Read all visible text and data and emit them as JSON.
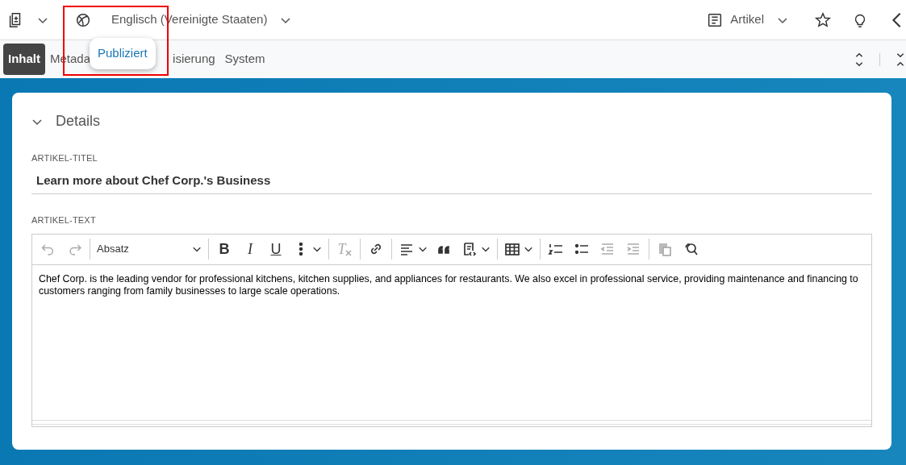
{
  "topbar": {
    "language": "Englisch (Vereinigte Staaten)",
    "doctype": "Artikel"
  },
  "status_tooltip": "Publiziert",
  "highlight": true,
  "tabs": [
    {
      "label": "Inhalt",
      "selected": true
    },
    {
      "label": "Metada",
      "selected": false
    },
    {
      "label": "isierung",
      "selected": false
    },
    {
      "label": "System",
      "selected": false
    }
  ],
  "section": {
    "title": "Details",
    "expanded": true
  },
  "fields": [
    {
      "label": "ARTIKEL-TITEL",
      "value": "Learn more about Chef Corp.'s Business"
    }
  ],
  "editor": {
    "label": "ARTIKEL-TEXT",
    "toolbar": [
      {
        "kind": "undo",
        "disabled": true
      },
      {
        "kind": "redo",
        "disabled": true
      },
      {
        "kind": "sep"
      },
      {
        "kind": "dropdown",
        "label": "Absatz"
      },
      {
        "kind": "sep"
      },
      {
        "kind": "bold",
        "label": "B",
        "disabled": false
      },
      {
        "kind": "italic",
        "label": "I",
        "disabled": false
      },
      {
        "kind": "underline",
        "label": "U",
        "disabled": false
      },
      {
        "kind": "more",
        "disabled": false
      },
      {
        "kind": "sep"
      },
      {
        "kind": "clear",
        "label": "T",
        "disabled": true
      },
      {
        "kind": "sep"
      },
      {
        "kind": "link",
        "disabled": false
      },
      {
        "kind": "sep"
      },
      {
        "kind": "align",
        "disabled": false
      },
      {
        "kind": "quote",
        "disabled": false
      },
      {
        "kind": "template",
        "disabled": false
      },
      {
        "kind": "sep"
      },
      {
        "kind": "table",
        "disabled": false
      },
      {
        "kind": "sep"
      },
      {
        "kind": "numbered",
        "disabled": false
      },
      {
        "kind": "bulleted",
        "disabled": false
      },
      {
        "kind": "outdent",
        "disabled": true
      },
      {
        "kind": "indent",
        "disabled": true
      },
      {
        "kind": "sep"
      },
      {
        "kind": "paste",
        "disabled": true
      },
      {
        "kind": "find",
        "disabled": false
      }
    ],
    "content": "Chef Corp. is the leading vendor for professional kitchens, kitchen supplies, and appliances for restaurants. We also excel in professional service, providing maintenance and financing to customers ranging from family businesses to large scale operations."
  }
}
